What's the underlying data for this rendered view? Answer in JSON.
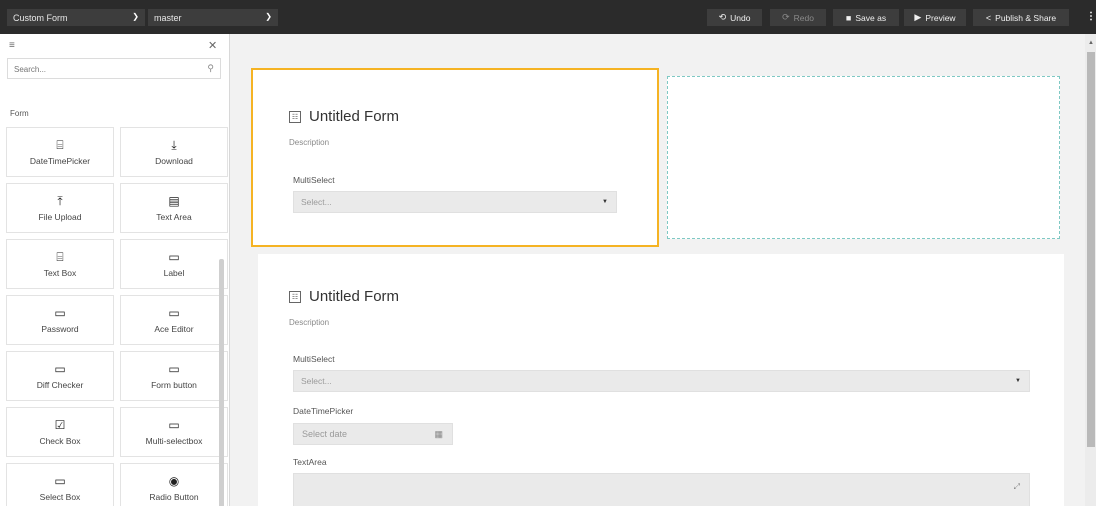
{
  "topbar": {
    "form_select": "Custom Form",
    "branch_select": "master",
    "undo": "Undo",
    "redo": "Redo",
    "save_as": "Save as",
    "preview": "Preview",
    "publish": "Publish & Share"
  },
  "sidebar": {
    "search_placeholder": "Search...",
    "heading": "Form",
    "items": [
      {
        "label": "DateTimePicker",
        "icon": "⌸"
      },
      {
        "label": "Download",
        "icon": "⤓"
      },
      {
        "label": "File Upload",
        "icon": "⤒"
      },
      {
        "label": "Text Area",
        "icon": "▤"
      },
      {
        "label": "Text Box",
        "icon": "⌸"
      },
      {
        "label": "Label",
        "icon": "▭"
      },
      {
        "label": "Password",
        "icon": "▭"
      },
      {
        "label": "Ace Editor",
        "icon": "▭"
      },
      {
        "label": "Diff Checker",
        "icon": "▭"
      },
      {
        "label": "Form button",
        "icon": "▭"
      },
      {
        "label": "Check Box",
        "icon": "☑"
      },
      {
        "label": "Multi-selectbox",
        "icon": "▭"
      },
      {
        "label": "Select Box",
        "icon": "▭"
      },
      {
        "label": "Radio Button",
        "icon": "◉"
      }
    ]
  },
  "canvas": {
    "card1": {
      "title": "Untitled Form",
      "description": "Description",
      "multiselect_label": "MultiSelect",
      "multiselect_placeholder": "Select..."
    },
    "card2": {
      "title": "Untitled Form",
      "description": "Description",
      "multiselect_label": "MultiSelect",
      "multiselect_placeholder": "Select...",
      "datetime_label": "DateTimePicker",
      "datetime_placeholder": "Select date",
      "textarea_label": "TextArea"
    }
  }
}
